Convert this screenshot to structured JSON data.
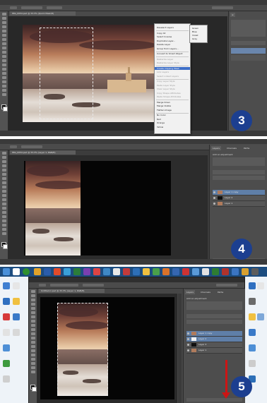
{
  "step3": {
    "step_number": "3",
    "doc_tab": "IMG_0054.psd @ 33.3% (Quick Mask/8)",
    "menu_items": [
      "File",
      "Edit",
      "Image",
      "Layer",
      "Type",
      "Select",
      "Filter",
      "3D",
      "View",
      "Window",
      "Help"
    ],
    "workspace": "Essentials",
    "context_menu": {
      "items": [
        {
          "label": "Deselect Layers",
          "state": "normal"
        },
        {
          "label": "Copy All",
          "state": "normal"
        },
        {
          "label": "Select Inverse",
          "state": "normal"
        },
        {
          "label": "Duplicate Layer...",
          "state": "normal"
        },
        {
          "label": "Delete Layer",
          "state": "normal"
        },
        {
          "label": "Group from Layers...",
          "state": "normal"
        },
        {
          "label": "Convert to Smart Object",
          "state": "normal"
        },
        {
          "label": "Rasterize Layer",
          "state": "disabled"
        },
        {
          "label": "Rasterize Layer Style",
          "state": "disabled"
        },
        {
          "label": "Create Clipping Mask",
          "state": "highlighted"
        },
        {
          "label": "Link Layers",
          "state": "disabled"
        },
        {
          "label": "Select Linked Layers",
          "state": "disabled"
        },
        {
          "label": "Copy Layer Style",
          "state": "disabled"
        },
        {
          "label": "Paste Layer Style",
          "state": "disabled"
        },
        {
          "label": "Clear Layer Style",
          "state": "disabled"
        },
        {
          "label": "Copy Shape Attributes",
          "state": "disabled"
        },
        {
          "label": "Paste Shape Attributes",
          "state": "disabled"
        },
        {
          "label": "Merge Down",
          "state": "normal"
        },
        {
          "label": "Merge Visible",
          "state": "normal"
        },
        {
          "label": "Flatten Image",
          "state": "normal"
        },
        {
          "label": "No Color",
          "state": "normal"
        },
        {
          "label": "Red",
          "state": "normal"
        },
        {
          "label": "Orange",
          "state": "normal"
        },
        {
          "label": "Yellow",
          "state": "normal"
        }
      ],
      "submenu": [
        "Green",
        "Blue",
        "Violet",
        "Gray"
      ]
    }
  },
  "step4": {
    "step_number": "4",
    "doc_tab": "IMG_0054.psd @ 33.3% (Layer 1, RGB/8)",
    "layers_panel": {
      "tabs": [
        "Layers",
        "Channels",
        "Paths"
      ],
      "adjustments_title": "Add an adjustment",
      "layers": [
        {
          "name": "Layer 1 copy",
          "selected": true
        },
        {
          "name": "Layer 2",
          "selected": false
        },
        {
          "name": "Layer 1",
          "selected": false
        }
      ]
    }
  },
  "step5": {
    "step_number": "5",
    "doc_tab": "Untitled-1.psd @ 33.3% (Layer 1, RGB/8)",
    "layers_panel": {
      "tabs": [
        "Layers",
        "Channels",
        "Paths"
      ],
      "adjustments_title": "Add an adjustment",
      "layers": [
        {
          "name": "Layer 1 copy",
          "selected": true
        },
        {
          "name": "Layer 2",
          "selected": true
        },
        {
          "name": "Layer 3",
          "selected": false
        },
        {
          "name": "Layer 1",
          "selected": false
        }
      ]
    }
  },
  "colors": {
    "step_badge": "#1c3f90",
    "highlight": "#3d6fc8",
    "arrow": "#cc1515",
    "taskbar": "#1d4d80"
  }
}
